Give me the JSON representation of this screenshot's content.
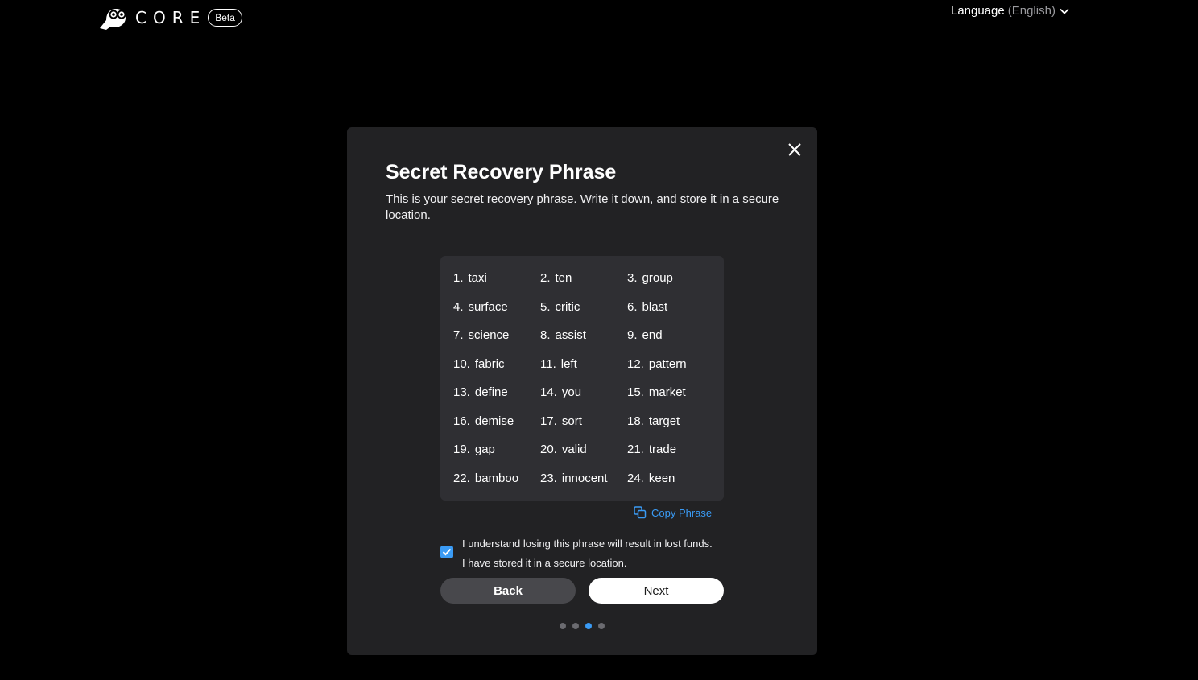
{
  "header": {
    "brand": "CORE",
    "badge": "Beta",
    "language_label": "Language",
    "language_value": "(English)"
  },
  "modal": {
    "title": "Secret Recovery Phrase",
    "description": "This is your secret recovery phrase. Write it down, and store it in a secure location.",
    "words": [
      {
        "num": "1.",
        "word": "taxi"
      },
      {
        "num": "2.",
        "word": "ten"
      },
      {
        "num": "3.",
        "word": "group"
      },
      {
        "num": "4.",
        "word": "surface"
      },
      {
        "num": "5.",
        "word": "critic"
      },
      {
        "num": "6.",
        "word": "blast"
      },
      {
        "num": "7.",
        "word": "science"
      },
      {
        "num": "8.",
        "word": "assist"
      },
      {
        "num": "9.",
        "word": "end"
      },
      {
        "num": "10.",
        "word": "fabric"
      },
      {
        "num": "11.",
        "word": "left"
      },
      {
        "num": "12.",
        "word": "pattern"
      },
      {
        "num": "13.",
        "word": "define"
      },
      {
        "num": "14.",
        "word": "you"
      },
      {
        "num": "15.",
        "word": "market"
      },
      {
        "num": "16.",
        "word": "demise"
      },
      {
        "num": "17.",
        "word": "sort"
      },
      {
        "num": "18.",
        "word": "target"
      },
      {
        "num": "19.",
        "word": "gap"
      },
      {
        "num": "20.",
        "word": "valid"
      },
      {
        "num": "21.",
        "word": "trade"
      },
      {
        "num": "22.",
        "word": "bamboo"
      },
      {
        "num": "23.",
        "word": "innocent"
      },
      {
        "num": "24.",
        "word": "keen"
      }
    ],
    "copy_label": "Copy Phrase",
    "terms_line1": "I understand losing this phrase will result in lost funds.",
    "terms_line2": "I have stored it in a secure location.",
    "terms_checked": true,
    "back_label": "Back",
    "next_label": "Next",
    "step_total": 4,
    "step_current": 3
  },
  "colors": {
    "accent": "#3a9bf5",
    "background": "#000000",
    "modal": "#222224",
    "phrase_box": "#2f2f33"
  },
  "icons": [
    "owl-logo-icon",
    "chevron-down-icon",
    "close-icon",
    "copy-icon",
    "checkmark-icon"
  ]
}
